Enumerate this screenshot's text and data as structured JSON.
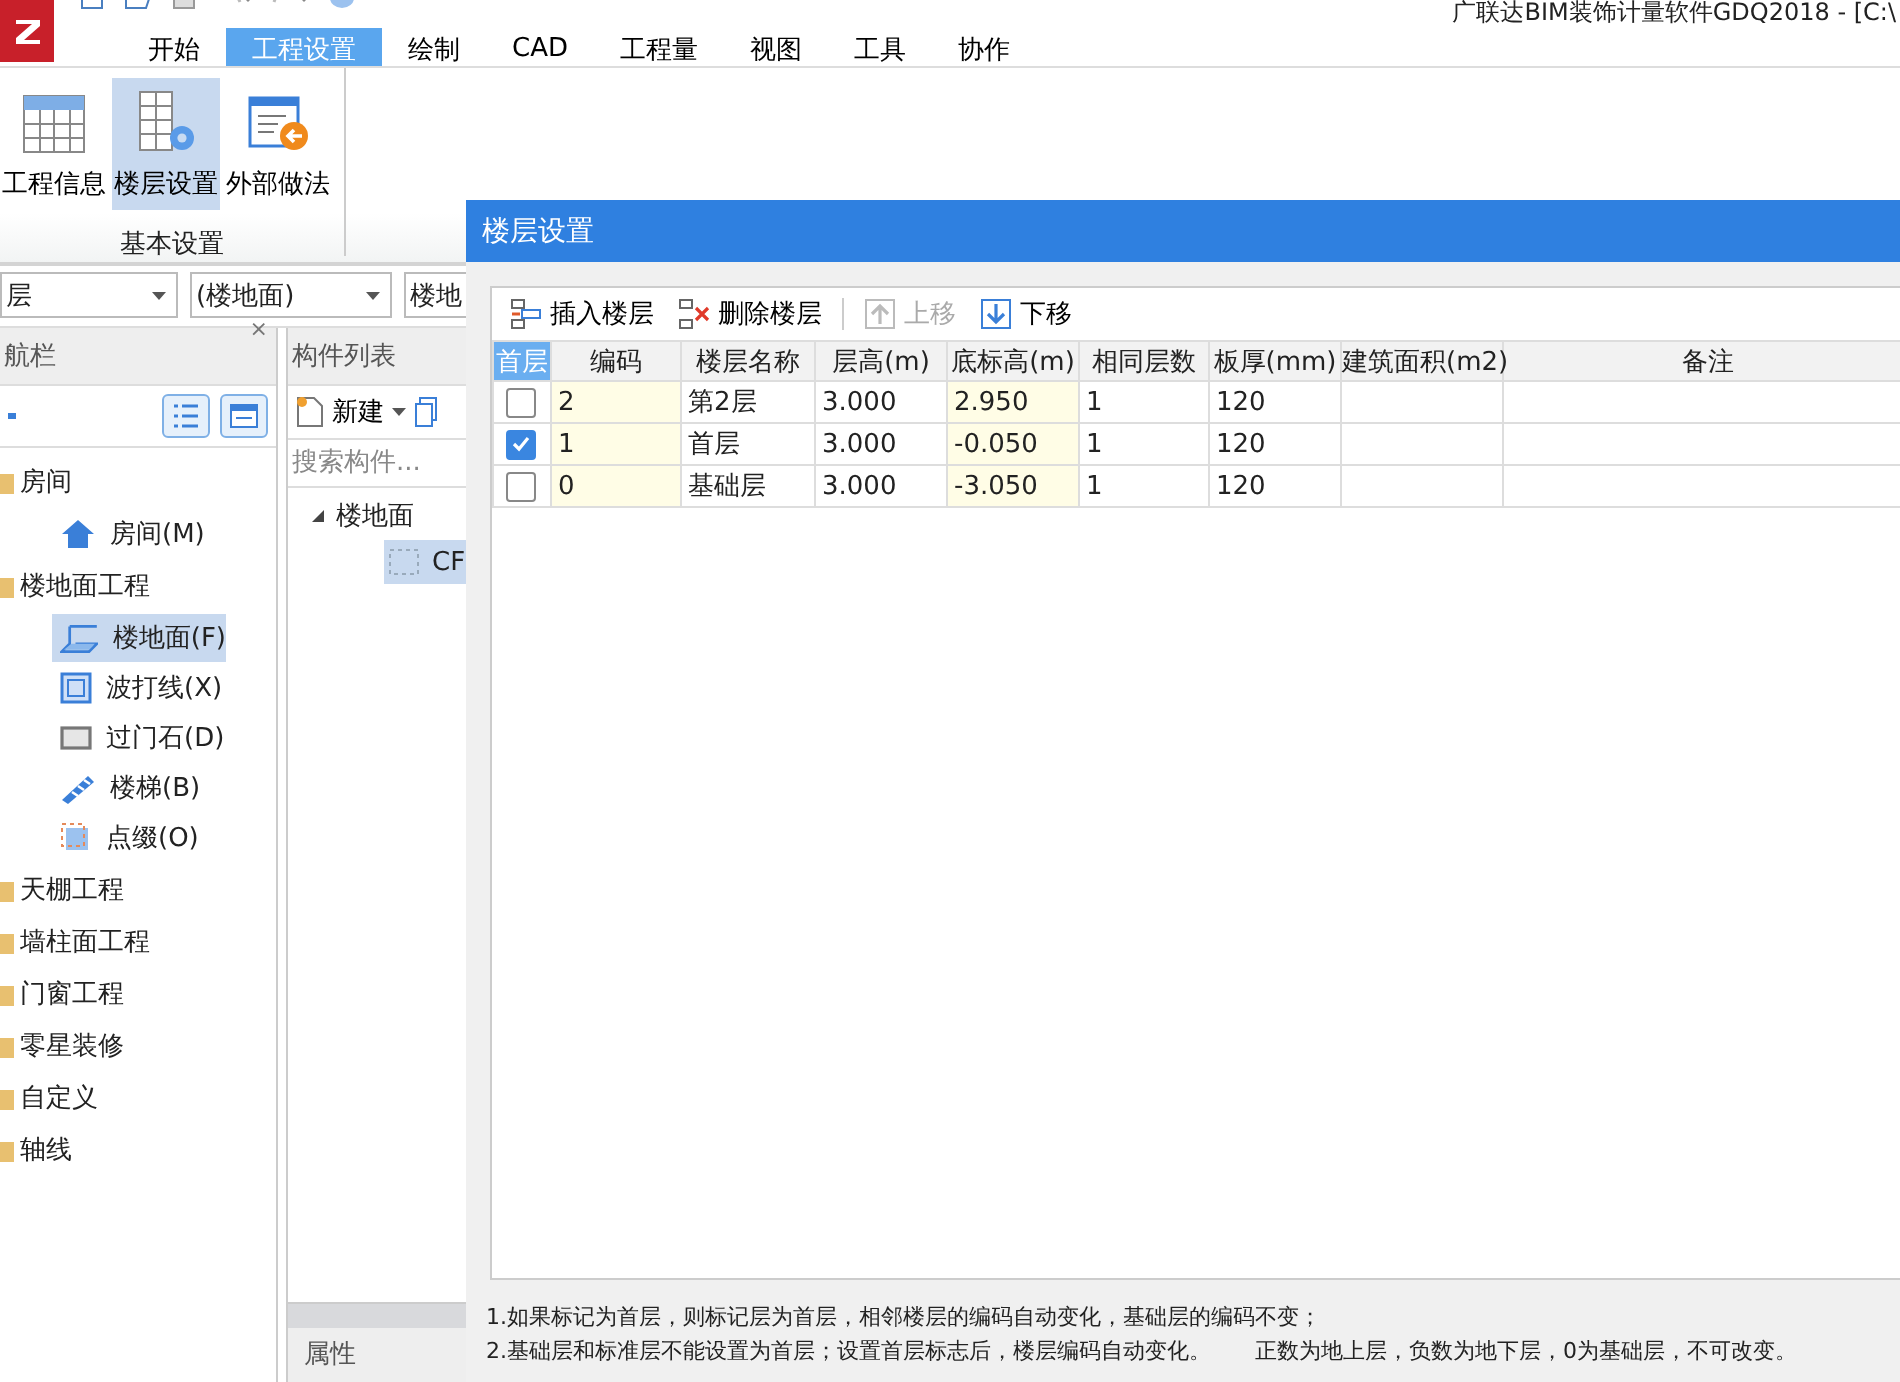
{
  "app": {
    "title": "广联达BIM装饰计量软件GDQ2018 - [C:\\"
  },
  "ribbon_tabs": [
    {
      "label": "开始",
      "selected": false
    },
    {
      "label": "工程设置",
      "selected": true
    },
    {
      "label": "绘制",
      "selected": false
    },
    {
      "label": "CAD",
      "selected": false
    },
    {
      "label": "工程量",
      "selected": false
    },
    {
      "label": "视图",
      "selected": false
    },
    {
      "label": "工具",
      "selected": false
    },
    {
      "label": "协作",
      "selected": false
    }
  ],
  "ribbon_buttons": [
    {
      "label": "工程信息",
      "selected": false
    },
    {
      "label": "楼层设置",
      "selected": true
    },
    {
      "label": "外部做法",
      "selected": false
    }
  ],
  "ribbon_group": "基本设置",
  "selectors": [
    "层",
    "(楼地面)",
    "楼地"
  ],
  "nav": {
    "title": "航栏",
    "close": "×",
    "tree": [
      {
        "label": "房间",
        "children": [
          {
            "label": "房间(M)",
            "selected": false
          }
        ]
      },
      {
        "label": "楼地面工程",
        "children": [
          {
            "label": "楼地面(F)",
            "selected": true
          },
          {
            "label": "波打线(X)",
            "selected": false
          },
          {
            "label": "过门石(D)",
            "selected": false
          },
          {
            "label": "楼梯(B)",
            "selected": false
          },
          {
            "label": "点缀(O)",
            "selected": false
          }
        ]
      },
      {
        "label": "天棚工程"
      },
      {
        "label": "墙柱面工程"
      },
      {
        "label": "门窗工程"
      },
      {
        "label": "零星装修"
      },
      {
        "label": "自定义"
      },
      {
        "label": "轴线"
      }
    ]
  },
  "component_list": {
    "title": "构件列表",
    "new_button": "新建",
    "search": {
      "placeholder": "搜索构件..."
    },
    "tree": [
      {
        "label": "楼地面",
        "expanded": true,
        "children": [
          {
            "label": "CF",
            "selected": true
          }
        ]
      }
    ]
  },
  "properties": {
    "title": "属性"
  },
  "dialog": {
    "title": "楼层设置",
    "toolbar": [
      {
        "label": "插入楼层",
        "disabled": false
      },
      {
        "label": "删除楼层",
        "disabled": false
      },
      {
        "label": "上移",
        "disabled": true
      },
      {
        "label": "下移",
        "disabled": false
      }
    ],
    "table": {
      "columns": [
        "首层",
        "编码",
        "楼层名称",
        "层高(m)",
        "底标高(m)",
        "相同层数",
        "板厚(mm)",
        "建筑面积(m2)",
        "备注"
      ],
      "rows": [
        {
          "first_floor": false,
          "cells": [
            "",
            "2",
            "第2层",
            "3.000",
            "2.950",
            "1",
            "120"
          ]
        },
        {
          "first_floor": true,
          "cells": [
            "",
            "1",
            "首层",
            "3.000",
            "-0.050",
            "1",
            "120"
          ]
        },
        {
          "first_floor": false,
          "cells": [
            "",
            "0",
            "基础层",
            "3.000",
            "-3.050",
            "1",
            "120"
          ]
        }
      ]
    },
    "notes": [
      [
        "1.如果标记为首层，则标记层为首层，相邻楼层的编码自动变化，基础层的编码不变；"
      ],
      [
        "2.基础层和标准层不能设置为首层；设置首层标志后，楼层编码自动变化。",
        "正数为地上层，负数为地下层，0为基础层，不可改变。"
      ]
    ]
  }
}
